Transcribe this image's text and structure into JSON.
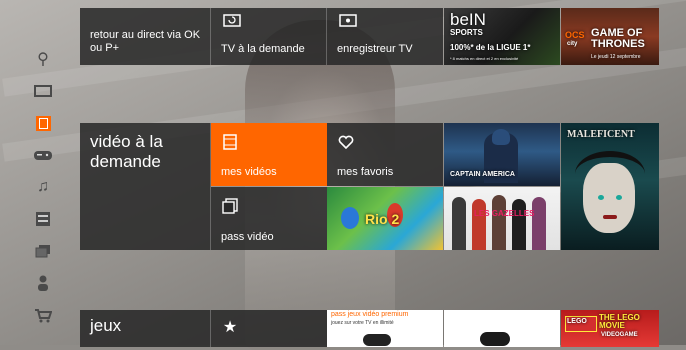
{
  "sidebar": {
    "items": [
      {
        "name": "search-icon",
        "glyph": "⚲"
      },
      {
        "name": "tv-icon",
        "glyph": "▭"
      },
      {
        "name": "video-icon",
        "glyph": ""
      },
      {
        "name": "gamepad-icon",
        "glyph": "🎮"
      },
      {
        "name": "music-icon",
        "glyph": "♫"
      },
      {
        "name": "apps-icon",
        "glyph": "▦"
      },
      {
        "name": "windows-icon",
        "glyph": "❐"
      },
      {
        "name": "user-icon",
        "glyph": "👤"
      },
      {
        "name": "cart-icon",
        "glyph": "🛒"
      }
    ]
  },
  "top_row": {
    "tile1_label": "retour au direct via OK ou P+",
    "tile2_label": "TV à la demande",
    "tile3_label": "enregistreur TV",
    "bein": {
      "brand": "beIN",
      "sub": "SPORTS",
      "caption": "100%* de la LIGUE 1*",
      "small": "* 8 matchs en direct et 2 en exclusivité"
    },
    "ocs": {
      "brand": "OCS",
      "sub": "city",
      "title": "GAME OF THRONES",
      "small": "Le jeudi 12 septembre"
    }
  },
  "vod": {
    "section_title": "vidéo à la demande",
    "mes_videos": "mes vidéos",
    "mes_favoris": "mes favoris",
    "pass_video": "pass vidéo",
    "posters": {
      "captain_america": "CAPTAIN AMERICA",
      "rio2": "Rio 2",
      "les_gazelles": "LES GAZELLES",
      "maleficent": "MALEFICENT"
    }
  },
  "games": {
    "section_title": "jeux",
    "promo_title": "pass jeux vidéo premium",
    "promo_sub": "jouez sur votre TV en illimité",
    "lego": "THE LEGO MOVIE",
    "lego_sub": "VIDEOGAME"
  },
  "colors": {
    "accent": "#ff6600",
    "tile_dark": "#282828"
  }
}
